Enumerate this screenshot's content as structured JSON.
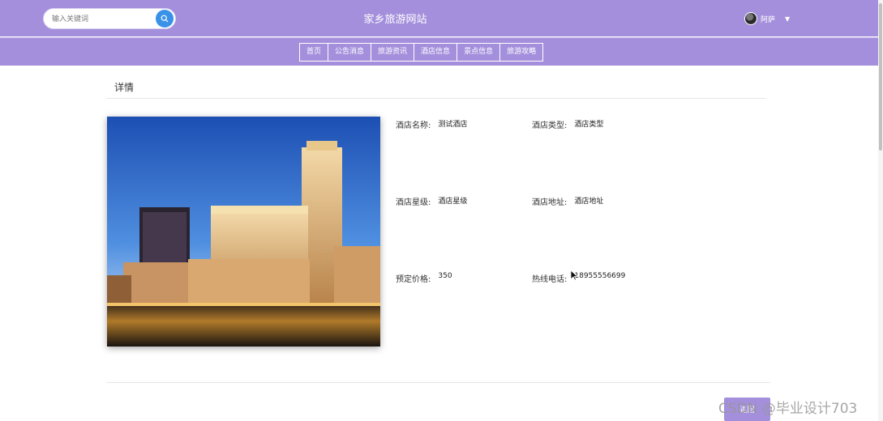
{
  "header": {
    "search_placeholder": "输入关键词",
    "site_title": "家乡旅游网站",
    "username": "阿萨"
  },
  "nav": {
    "items": [
      "首页",
      "公告消息",
      "旅游资讯",
      "酒店信息",
      "景点信息",
      "旅游攻略"
    ]
  },
  "detail": {
    "title": "详情",
    "fields": [
      {
        "label": "酒店名称:",
        "value": "测试酒店"
      },
      {
        "label": "酒店类型:",
        "value": "酒店类型"
      },
      {
        "label": "酒店星级:",
        "value": "酒店星级"
      },
      {
        "label": "酒店地址:",
        "value": "酒店地址"
      },
      {
        "label": "预定价格:",
        "value": "350"
      },
      {
        "label": "热线电话:",
        "value": "18955556699"
      }
    ],
    "back_label": "返回"
  },
  "watermark": "CSDN @毕业设计703",
  "colors": {
    "accent": "#a48fdc",
    "search_button": "#3a92e8"
  },
  "icons": {
    "search": "search-icon",
    "user_menu": "chevron-down-icon"
  }
}
